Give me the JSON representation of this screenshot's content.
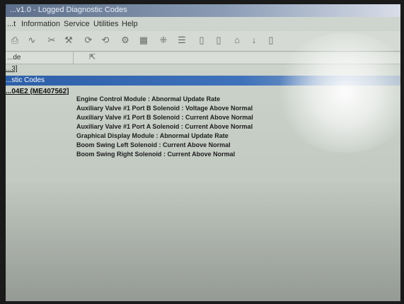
{
  "window": {
    "title": "...v1.0 - Logged Diagnostic Codes"
  },
  "menu": [
    {
      "label": "...t"
    },
    {
      "label": "Information"
    },
    {
      "label": "Service"
    },
    {
      "label": "Utilities"
    },
    {
      "label": "Help"
    }
  ],
  "toolbar": {
    "buttons": [
      {
        "icon": "print-icon"
      },
      {
        "icon": "wave-icon"
      },
      {
        "icon": "tool-icon"
      },
      {
        "icon": "wrench-icon"
      },
      {
        "icon": "refresh-icon"
      },
      {
        "icon": "refresh-icon"
      },
      {
        "icon": "gear-icon"
      },
      {
        "icon": "chip-icon"
      },
      {
        "icon": "module-icon"
      },
      {
        "icon": "list-icon"
      },
      {
        "icon": "doc-icon"
      },
      {
        "icon": "doc-icon"
      },
      {
        "icon": "home-icon"
      },
      {
        "icon": "arrow-icon"
      },
      {
        "icon": "doc-icon"
      }
    ]
  },
  "list_header": {
    "label": "...de"
  },
  "tree": {
    "link": "...3]",
    "selected": "...stic Codes",
    "node": "...04E2 (ME407562]"
  },
  "codes": [
    "Engine Control Module : Abnormal Update Rate",
    "Auxiliary Valve #1 Port B Solenoid : Voltage Above Normal",
    "Auxiliary Valve #1 Port B Solenoid : Current Above Normal",
    "Auxiliary Valve #1 Port A Solenoid : Current Above Normal",
    "Graphical Display Module : Abnormal Update Rate",
    "Boom Swing Left Solenoid : Current Above Normal",
    "Boom Swing Right Solenoid : Current Above Normal"
  ]
}
